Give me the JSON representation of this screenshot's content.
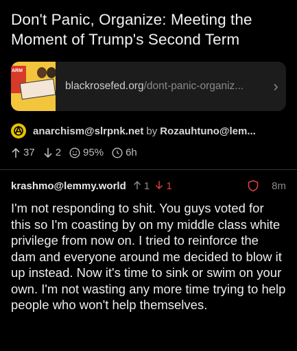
{
  "post": {
    "title": "Don't Panic, Organize: Meeting the Moment of Trump's Second Term",
    "link": {
      "domain": "blackrosefed.org",
      "path": "/dont-panic-organiz...",
      "chevron_icon": "chevron-right-icon",
      "thumb_label": "ARM"
    },
    "community": "anarchism@slrpnk.net",
    "by": "by",
    "author": "Rozauhtuno@lem...",
    "stats": {
      "upvotes": "37",
      "downvotes": "2",
      "percent": "95%",
      "age": "6h"
    }
  },
  "comment": {
    "user": "krashmo@lemmy.world",
    "upvotes": "1",
    "downvotes": "1",
    "age": "8m",
    "body": "I'm not responding to shit. You guys voted for this so I'm coasting by on my middle class white privilege from now on. I tried to reinforce the dam and everyone around me decided to blow it up instead. Now it's time to sink or swim on your own. I'm not wasting any more time trying to help people who won't help themselves."
  },
  "colors": {
    "background": "#000000",
    "downvote": "#e04040",
    "card": "#1c1c1c"
  }
}
